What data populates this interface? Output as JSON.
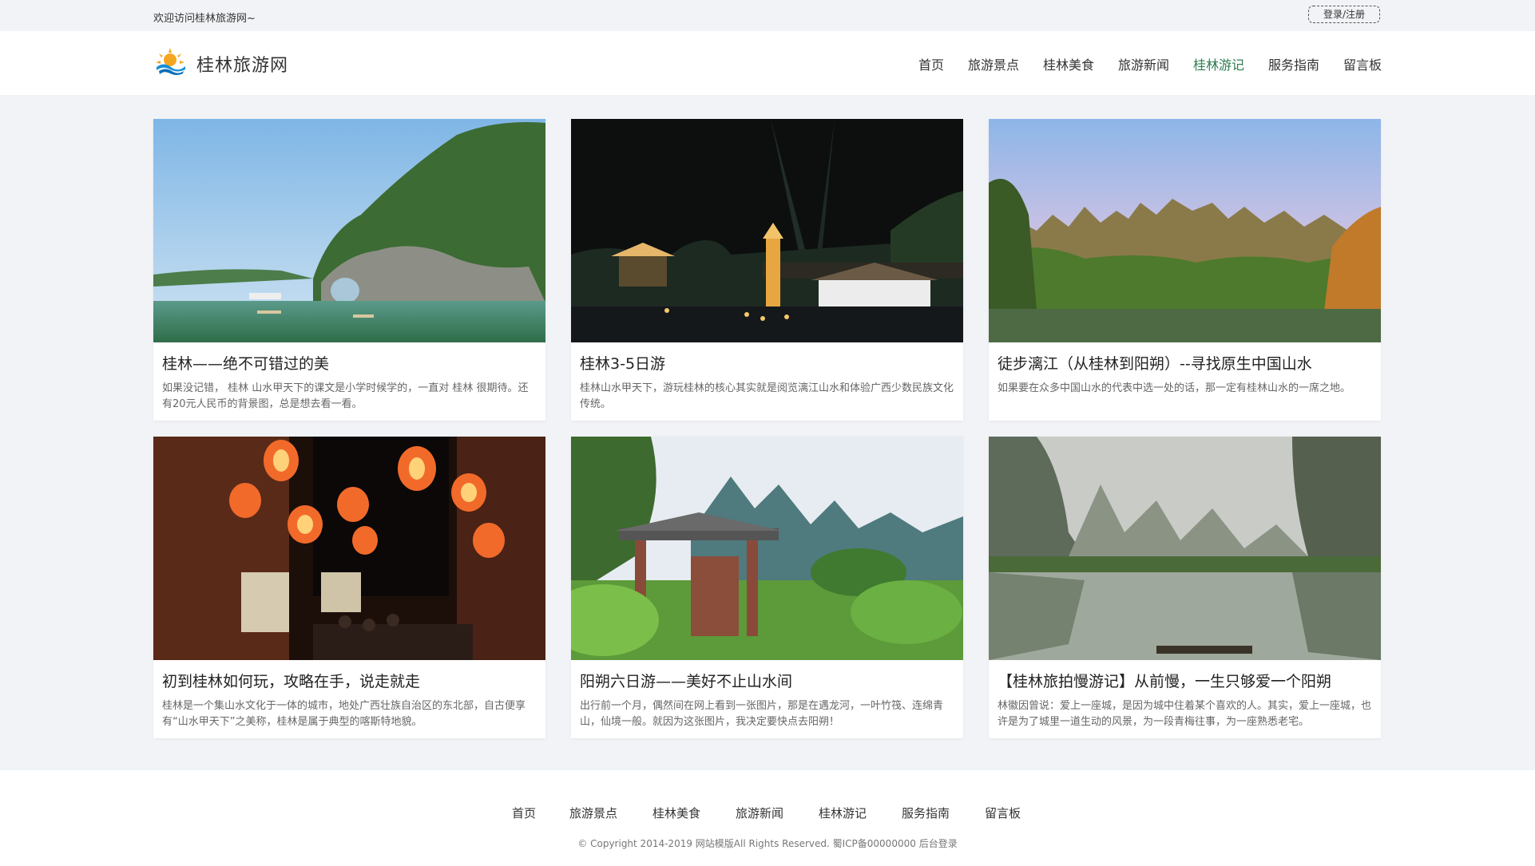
{
  "topbar": {
    "welcome": "欢迎访问桂林旅游网~",
    "login": "登录/注册"
  },
  "header": {
    "site_name": "桂林旅游网",
    "nav": [
      "首页",
      "旅游景点",
      "桂林美食",
      "旅游新闻",
      "桂林游记",
      "服务指南",
      "留言板"
    ],
    "active_index": 4,
    "active_color": "#2e7d4f"
  },
  "cards": [
    {
      "title": "桂林——绝不可错过的美",
      "desc": "如果没记错， 桂林 山水甲天下的课文是小学时候学的，一直对 桂林 很期待。还有20元人民币的背景图，总是想去看一看。"
    },
    {
      "title": "桂林3-5日游",
      "desc": "桂林山水甲天下，游玩桂林的核心其实就是阅览漓江山水和体验广西少数民族文化传统。"
    },
    {
      "title": "徒步漓江（从桂林到阳朔）--寻找原生中国山水",
      "desc": "如果要在众多中国山水的代表中选一处的话，那一定有桂林山水的一席之地。"
    },
    {
      "title": "初到桂林如何玩，攻略在手，说走就走",
      "desc": "桂林是一个集山水文化于一体的城市，地处广西壮族自治区的东北部，自古便享有“山水甲天下”之美称，桂林是属于典型的喀斯特地貌。"
    },
    {
      "title": "阳朔六日游——美好不止山水间",
      "desc": "出行前一个月，偶然间在网上看到一张图片，那是在遇龙河，一叶竹筏、连绵青山，仙境一般。就因为这张图片，我决定要快点去阳朔！"
    },
    {
      "title": "【桂林旅拍慢游记】从前慢，一生只够爱一个阳朔",
      "desc": "林徽因曾说：爱上一座城，是因为城中住着某个喜欢的人。其实，爱上一座城，也许是为了城里一道生动的风景，为一段青梅往事，为一座熟悉老宅。"
    }
  ],
  "footer": {
    "nav": [
      "首页",
      "旅游景点",
      "桂林美食",
      "旅游新闻",
      "桂林游记",
      "服务指南",
      "留言板"
    ],
    "copyright": "© Copyright 2014-2019 网站模版All Rights Reserved. 蜀ICP备00000000",
    "admin_link": "后台登录"
  }
}
